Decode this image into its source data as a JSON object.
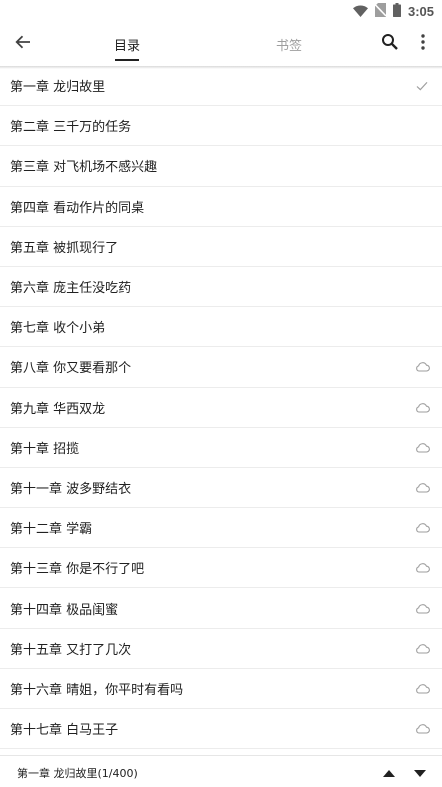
{
  "status_bar": {
    "time": "3:05",
    "icons": [
      "wifi-icon",
      "no-sim-icon",
      "battery-icon"
    ]
  },
  "toolbar": {
    "back_icon": "arrow-left-icon",
    "tabs": [
      {
        "label": "目录",
        "active": true
      },
      {
        "label": "书签",
        "active": false
      }
    ],
    "search_icon": "search-icon",
    "more_icon": "more-vertical-icon"
  },
  "chapters": [
    {
      "title": "第一章 龙归故里",
      "status": "check"
    },
    {
      "title": "第二章 三千万的任务",
      "status": "none"
    },
    {
      "title": "第三章 对飞机场不感兴趣",
      "status": "none"
    },
    {
      "title": "第四章 看动作片的同桌",
      "status": "none"
    },
    {
      "title": "第五章 被抓现行了",
      "status": "none"
    },
    {
      "title": "第六章 庞主任没吃药",
      "status": "none"
    },
    {
      "title": "第七章 收个小弟",
      "status": "none"
    },
    {
      "title": "第八章 你又要看那个",
      "status": "cloud"
    },
    {
      "title": "第九章 华西双龙",
      "status": "cloud"
    },
    {
      "title": "第十章 招揽",
      "status": "cloud"
    },
    {
      "title": "第十一章 波多野结衣",
      "status": "cloud"
    },
    {
      "title": "第十二章 学霸",
      "status": "cloud"
    },
    {
      "title": "第十三章 你是不行了吧",
      "status": "cloud"
    },
    {
      "title": "第十四章 极品闺蜜",
      "status": "cloud"
    },
    {
      "title": "第十五章 又打了几次",
      "status": "cloud"
    },
    {
      "title": "第十六章 晴姐，你平时有看吗",
      "status": "cloud"
    },
    {
      "title": "第十七章 白马王子",
      "status": "cloud"
    }
  ],
  "bottom_bar": {
    "progress": "第一章 龙归故里(1/400)",
    "up_icon": "triangle-up-icon",
    "down_icon": "triangle-down-icon"
  },
  "colors": {
    "text": "#212121",
    "muted": "#9e9e9e",
    "divider": "#ececec",
    "icon": "#9e9e9e"
  }
}
